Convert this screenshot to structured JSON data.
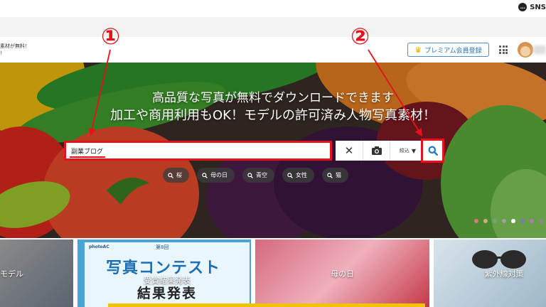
{
  "top": {
    "sns_label": "SNS"
  },
  "header": {
    "tagline_line1": "素材が無料！",
    "tagline_line2": "！",
    "premium_label": "プレミアム会員登録"
  },
  "hero": {
    "title_line1": "高品質な写真が無料でダウンロードできます",
    "title_line2": "加工や商用利用もOK！モデルの許可済み人物写真素材！",
    "search": {
      "value": "副業ブログ"
    },
    "filter_label": "絞込",
    "chips": [
      "桜",
      "母の日",
      "青空",
      "女性",
      "猫"
    ]
  },
  "annotations": {
    "num1": "①",
    "num2": "②"
  },
  "cards": {
    "card1_label": "モデル",
    "card2": {
      "logo": "photoAC",
      "edition": "第8回",
      "title": "写真コンテスト",
      "subtitle": "受賞結果発表",
      "result": "結果発表"
    },
    "card3_label": "母の日",
    "card4_label": "紫外線対策"
  },
  "colors": {
    "annotation_red": "#e8101a",
    "premium_blue": "#2a6fb0",
    "search_blue": "#1e78c8"
  }
}
